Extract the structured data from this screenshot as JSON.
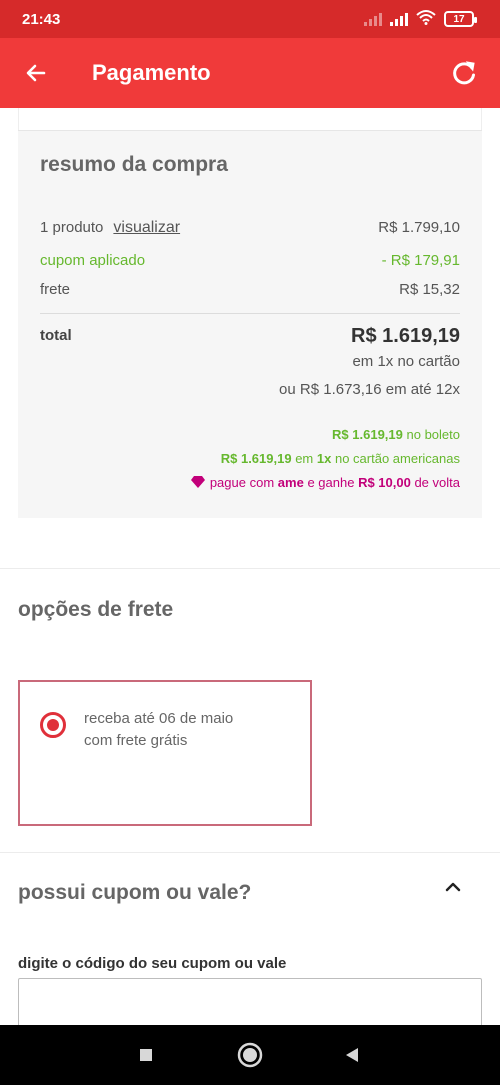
{
  "status_bar": {
    "time": "21:43",
    "battery": "17",
    "icons": [
      "signal-dim-icon",
      "signal-icon",
      "wifi-icon",
      "battery-icon"
    ]
  },
  "app_bar": {
    "title": "Pagamento",
    "back_icon": "arrow-left-icon",
    "refresh_icon": "refresh-icon",
    "color": "#f03a3a"
  },
  "summary": {
    "title": "resumo da compra",
    "product_label": "1 produto",
    "view_link": "visualizar",
    "product_value": "R$ 1.799,10",
    "coupon_label": "cupom aplicado",
    "coupon_value": "- R$ 179,91",
    "shipping_label": "frete",
    "shipping_value": "R$ 15,32",
    "total_label": "total",
    "total_value": "R$ 1.619,19",
    "total_card_line": "em 1x no cartão",
    "total_installments": "ou R$ 1.673,16 em até 12x",
    "boleto": {
      "amount": "R$ 1.619,19",
      "text": "no boleto"
    },
    "americanas_card": {
      "amount": "R$ 1.619,19",
      "middle": "em",
      "times": "1x",
      "text": "no cartão americanas"
    },
    "ame": {
      "prefix": "pague com",
      "brand": "ame",
      "middle": "e ganhe",
      "amount": "R$ 10,00",
      "suffix": "de volta",
      "icon": "diamond-icon"
    }
  },
  "shipping": {
    "title": "opções de frete",
    "option_line1": "receba até 06 de maio",
    "option_line2": "com frete grátis",
    "selected": true
  },
  "coupon": {
    "title": "possui cupom ou vale?",
    "chevron_icon": "chevron-up-icon",
    "field_label": "digite o código do seu cupom ou vale",
    "value": "",
    "placeholder": ""
  },
  "nav_bar": {
    "icons": [
      "square-icon",
      "circle-home-icon",
      "triangle-back-icon"
    ]
  },
  "colors": {
    "accent": "#f03a3a",
    "green": "#66b82e",
    "ame": "#c2007a",
    "radio": "#e0303a"
  }
}
